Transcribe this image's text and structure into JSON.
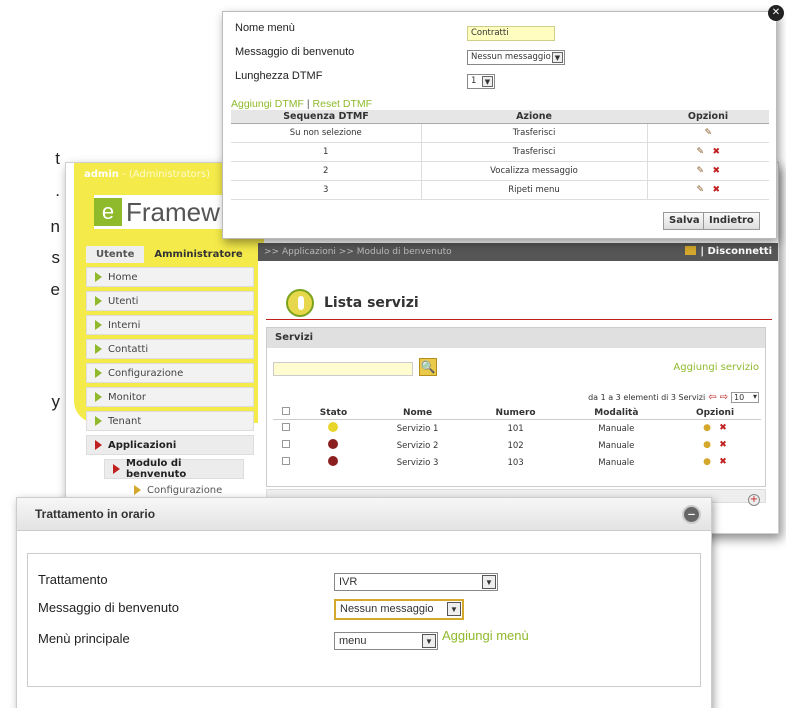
{
  "background_fragments": [
    "t",
    ".",
    "n",
    "s",
    "e",
    "y"
  ],
  "main": {
    "admin_user": "admin",
    "admin_role": " - (Administrators)",
    "logo_letter": "e",
    "logo_text": "Framew",
    "tabs": [
      "Utente",
      "Amministratore"
    ],
    "nav": [
      "Home",
      "Utenti",
      "Interni",
      "Contatti",
      "Configurazione",
      "Monitor",
      "Tenant",
      "Applicazioni"
    ],
    "nav_sub": "Modulo di benvenuto",
    "nav_sub2": "Configurazione",
    "breadcrumb": ">> Applicazioni >> Modulo di benvenuto",
    "logout": "| Disconnetti",
    "page_title": "Lista servizi",
    "section": "Servizi",
    "add_service": "Aggiungi servizio",
    "pager_text": "da 1 a 3 elementi di 3 Servizi",
    "page_size": "10",
    "columns": [
      "Stato",
      "Nome",
      "Numero",
      "Modalità",
      "Opzioni"
    ],
    "rows": [
      {
        "status_color": "#e8d52a",
        "name": "Servizio 1",
        "number": "101",
        "mode": "Manuale"
      },
      {
        "status_color": "#8b1f1f",
        "name": "Servizio 2",
        "number": "102",
        "mode": "Manuale"
      },
      {
        "status_color": "#8b1f1f",
        "name": "Servizio 3",
        "number": "103",
        "mode": "Manuale"
      }
    ]
  },
  "dtmf": {
    "label_name": "Nome menù",
    "value_name": "Contratti",
    "label_msg": "Messaggio di benvenuto",
    "value_msg": "Nessun messaggio",
    "label_len": "Lunghezza DTMF",
    "value_len": "1",
    "link_add": "Aggiungi DTMF",
    "link_sep": "|",
    "link_reset": "Reset DTMF",
    "columns": [
      "Sequenza DTMF",
      "Azione",
      "Opzioni"
    ],
    "rows": [
      {
        "seq": "Su non selezione",
        "action": "Trasferisci"
      },
      {
        "seq": "1",
        "action": "Trasferisci"
      },
      {
        "seq": "2",
        "action": "Vocalizza messaggio"
      },
      {
        "seq": "3",
        "action": "Ripeti menu"
      }
    ],
    "save": "Salva",
    "back": "Indietro"
  },
  "tratt": {
    "title": "Trattamento in orario",
    "label_tratt": "Trattamento",
    "value_tratt": "IVR",
    "label_msg": "Messaggio di benvenuto",
    "value_msg": "Nessun messaggio",
    "label_menu": "Menù principale",
    "value_menu": "menu",
    "add_menu": "Aggiungi menù"
  },
  "accent_green": "#8fba2c",
  "accent_yellow": "#f4ea4a"
}
